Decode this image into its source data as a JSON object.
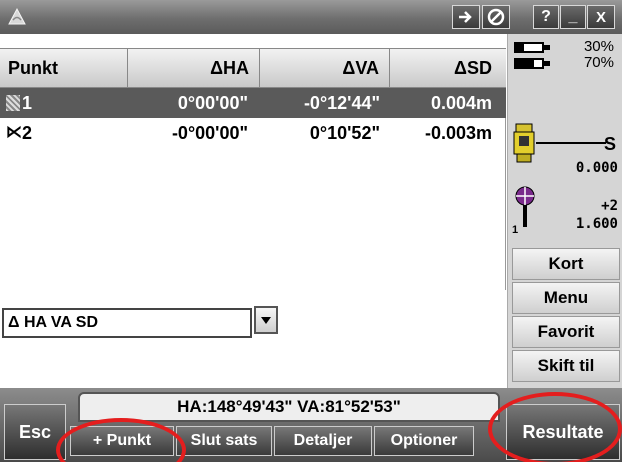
{
  "titlebar": {
    "icons": [
      "transfer-icon",
      "power-icon"
    ],
    "help_label": "?",
    "minimize_label": "_",
    "close_label": "X"
  },
  "table": {
    "headers": [
      "Punkt",
      "ΔHA",
      "ΔVA",
      "ΔSD"
    ],
    "rows": [
      {
        "punkt": "1",
        "dha": "0°00'00\"",
        "dva": "-0°12'44\"",
        "dsd": "0.004m",
        "selected": true
      },
      {
        "punkt": "2",
        "dha": "-0°00'00\"",
        "dva": "0°10'52\"",
        "dsd": "-0.003m",
        "selected": false
      }
    ],
    "row2_marker": "⋉"
  },
  "status": {
    "battery_1": "30%",
    "battery_1_level": 0.3,
    "battery_2": "70%",
    "battery_2_level": 0.7,
    "instrument_face": "S",
    "instrument_value": "0.000",
    "target_number": "1",
    "target_offset": "+2",
    "target_height": "1.600"
  },
  "side_buttons": {
    "kort": "Kort",
    "menu": "Menu",
    "favorit": "Favorit",
    "skift": "Skift til"
  },
  "view_select": {
    "value": "Δ HA VA SD"
  },
  "status_line": "HA:148°49'43\"  VA:81°52'53\"",
  "bottom": {
    "esc": "Esc",
    "result": "Resultate",
    "tabs": [
      "+ Punkt",
      "Slut sats",
      "Detaljer",
      "Optioner"
    ]
  },
  "colors": {
    "annotation": "#e41e1e",
    "selected_row": "#5a5a5a"
  }
}
